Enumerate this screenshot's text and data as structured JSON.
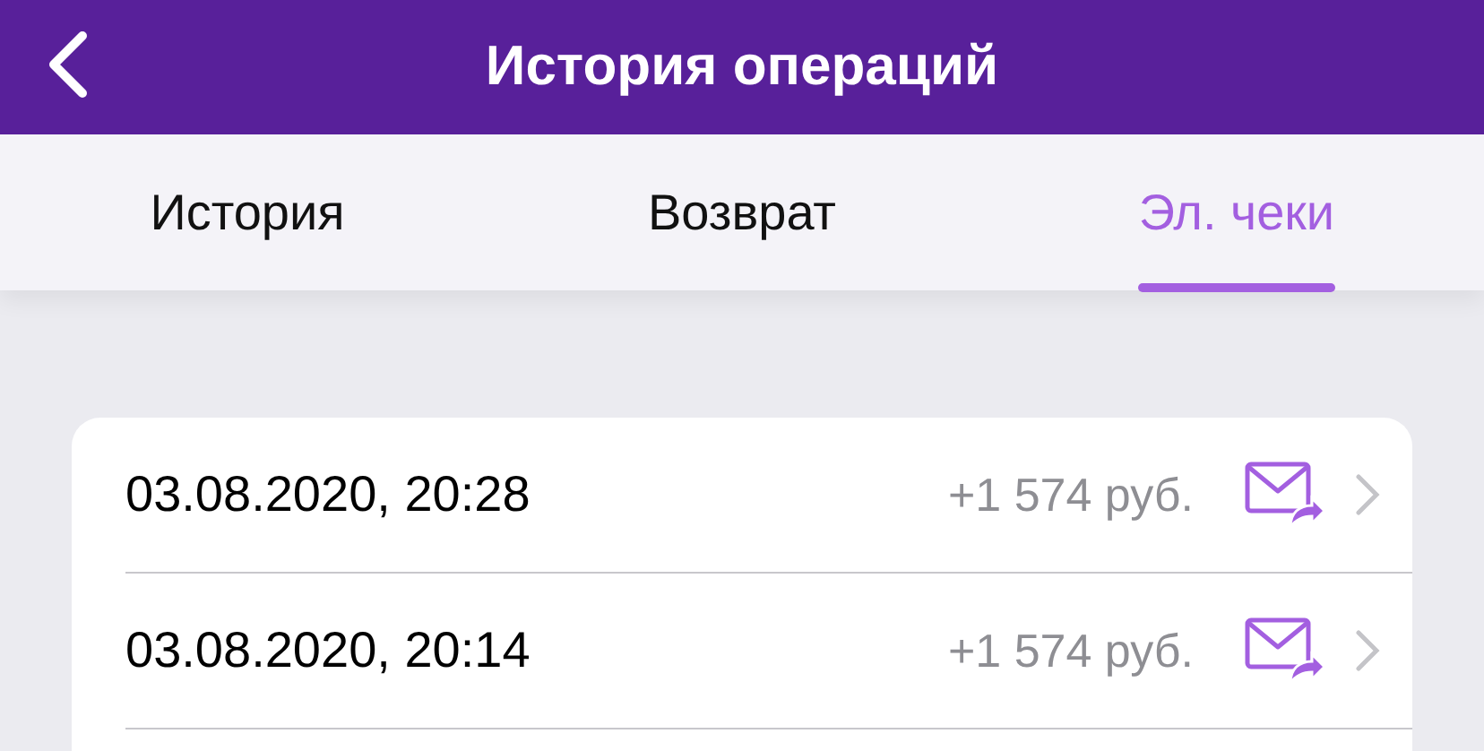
{
  "header": {
    "title": "История операций"
  },
  "tabs": [
    {
      "label": "История",
      "selected": false
    },
    {
      "label": "Возврат",
      "selected": false
    },
    {
      "label": "Эл. чеки",
      "selected": true
    }
  ],
  "receipts": [
    {
      "datetime": "03.08.2020, 20:28",
      "amount": "+1 574 руб."
    },
    {
      "datetime": "03.08.2020, 20:14",
      "amount": "+1 574 руб."
    }
  ]
}
